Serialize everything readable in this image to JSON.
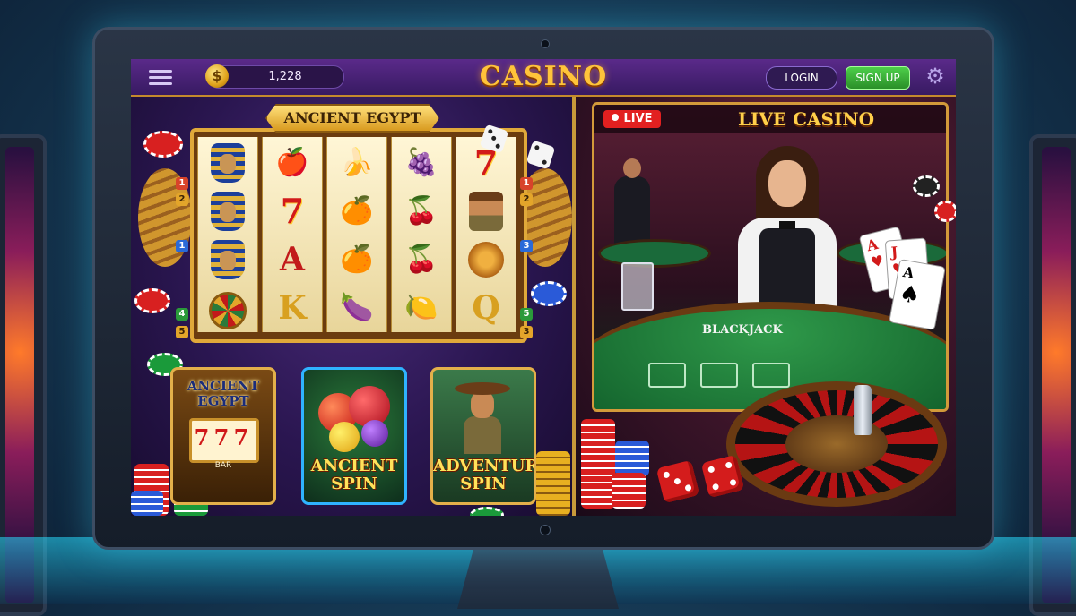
{
  "header": {
    "balance": "1,228",
    "coin_symbol": "$",
    "brand": "CASINO",
    "login_label": "LOGIN",
    "signup_label": "SIGN UP"
  },
  "slot": {
    "banner": "ANCIENT EGYPT",
    "reels": [
      [
        "pharaoh",
        "pharaoh",
        "pharaoh",
        "wheel"
      ],
      [
        "🍎",
        "7",
        "A",
        "K"
      ],
      [
        "🍌",
        "🍊",
        "🍊",
        "🍆"
      ],
      [
        "🍇",
        "🍒",
        "🍒",
        "🍋"
      ],
      [
        "7",
        "explorer",
        "lion",
        "Q"
      ]
    ],
    "left_lines": [
      "1",
      "2",
      "1",
      "4",
      "5"
    ],
    "right_lines": [
      "1",
      "2",
      "3",
      "5",
      "3"
    ]
  },
  "games": [
    {
      "title": "ANCIENT EGYPT",
      "reel_symbols": [
        "7",
        "7",
        "7"
      ],
      "reel_caption": "BAR"
    },
    {
      "title": "ANCIENT SPIN"
    },
    {
      "title": "ADVENTURE SPIN"
    }
  ],
  "live": {
    "badge": "LIVE",
    "title": "LIVE CASINO",
    "table_label": "BLACKJACK",
    "cards": [
      {
        "rank": "A",
        "suit": "♥",
        "color": "#d21a1a"
      },
      {
        "rank": "J",
        "suit": "♥",
        "color": "#d21a1a"
      },
      {
        "rank": "A",
        "suit": "♠",
        "color": "#111111"
      }
    ]
  },
  "colors": {
    "brand_gold": "#ffc43a",
    "signup_green": "#2a8f28",
    "live_red": "#e22020",
    "felt_green": "#1f7a3a"
  },
  "icons": {
    "menu": "hamburger-menu-icon",
    "settings": "gear-icon",
    "coin": "coin-icon"
  }
}
